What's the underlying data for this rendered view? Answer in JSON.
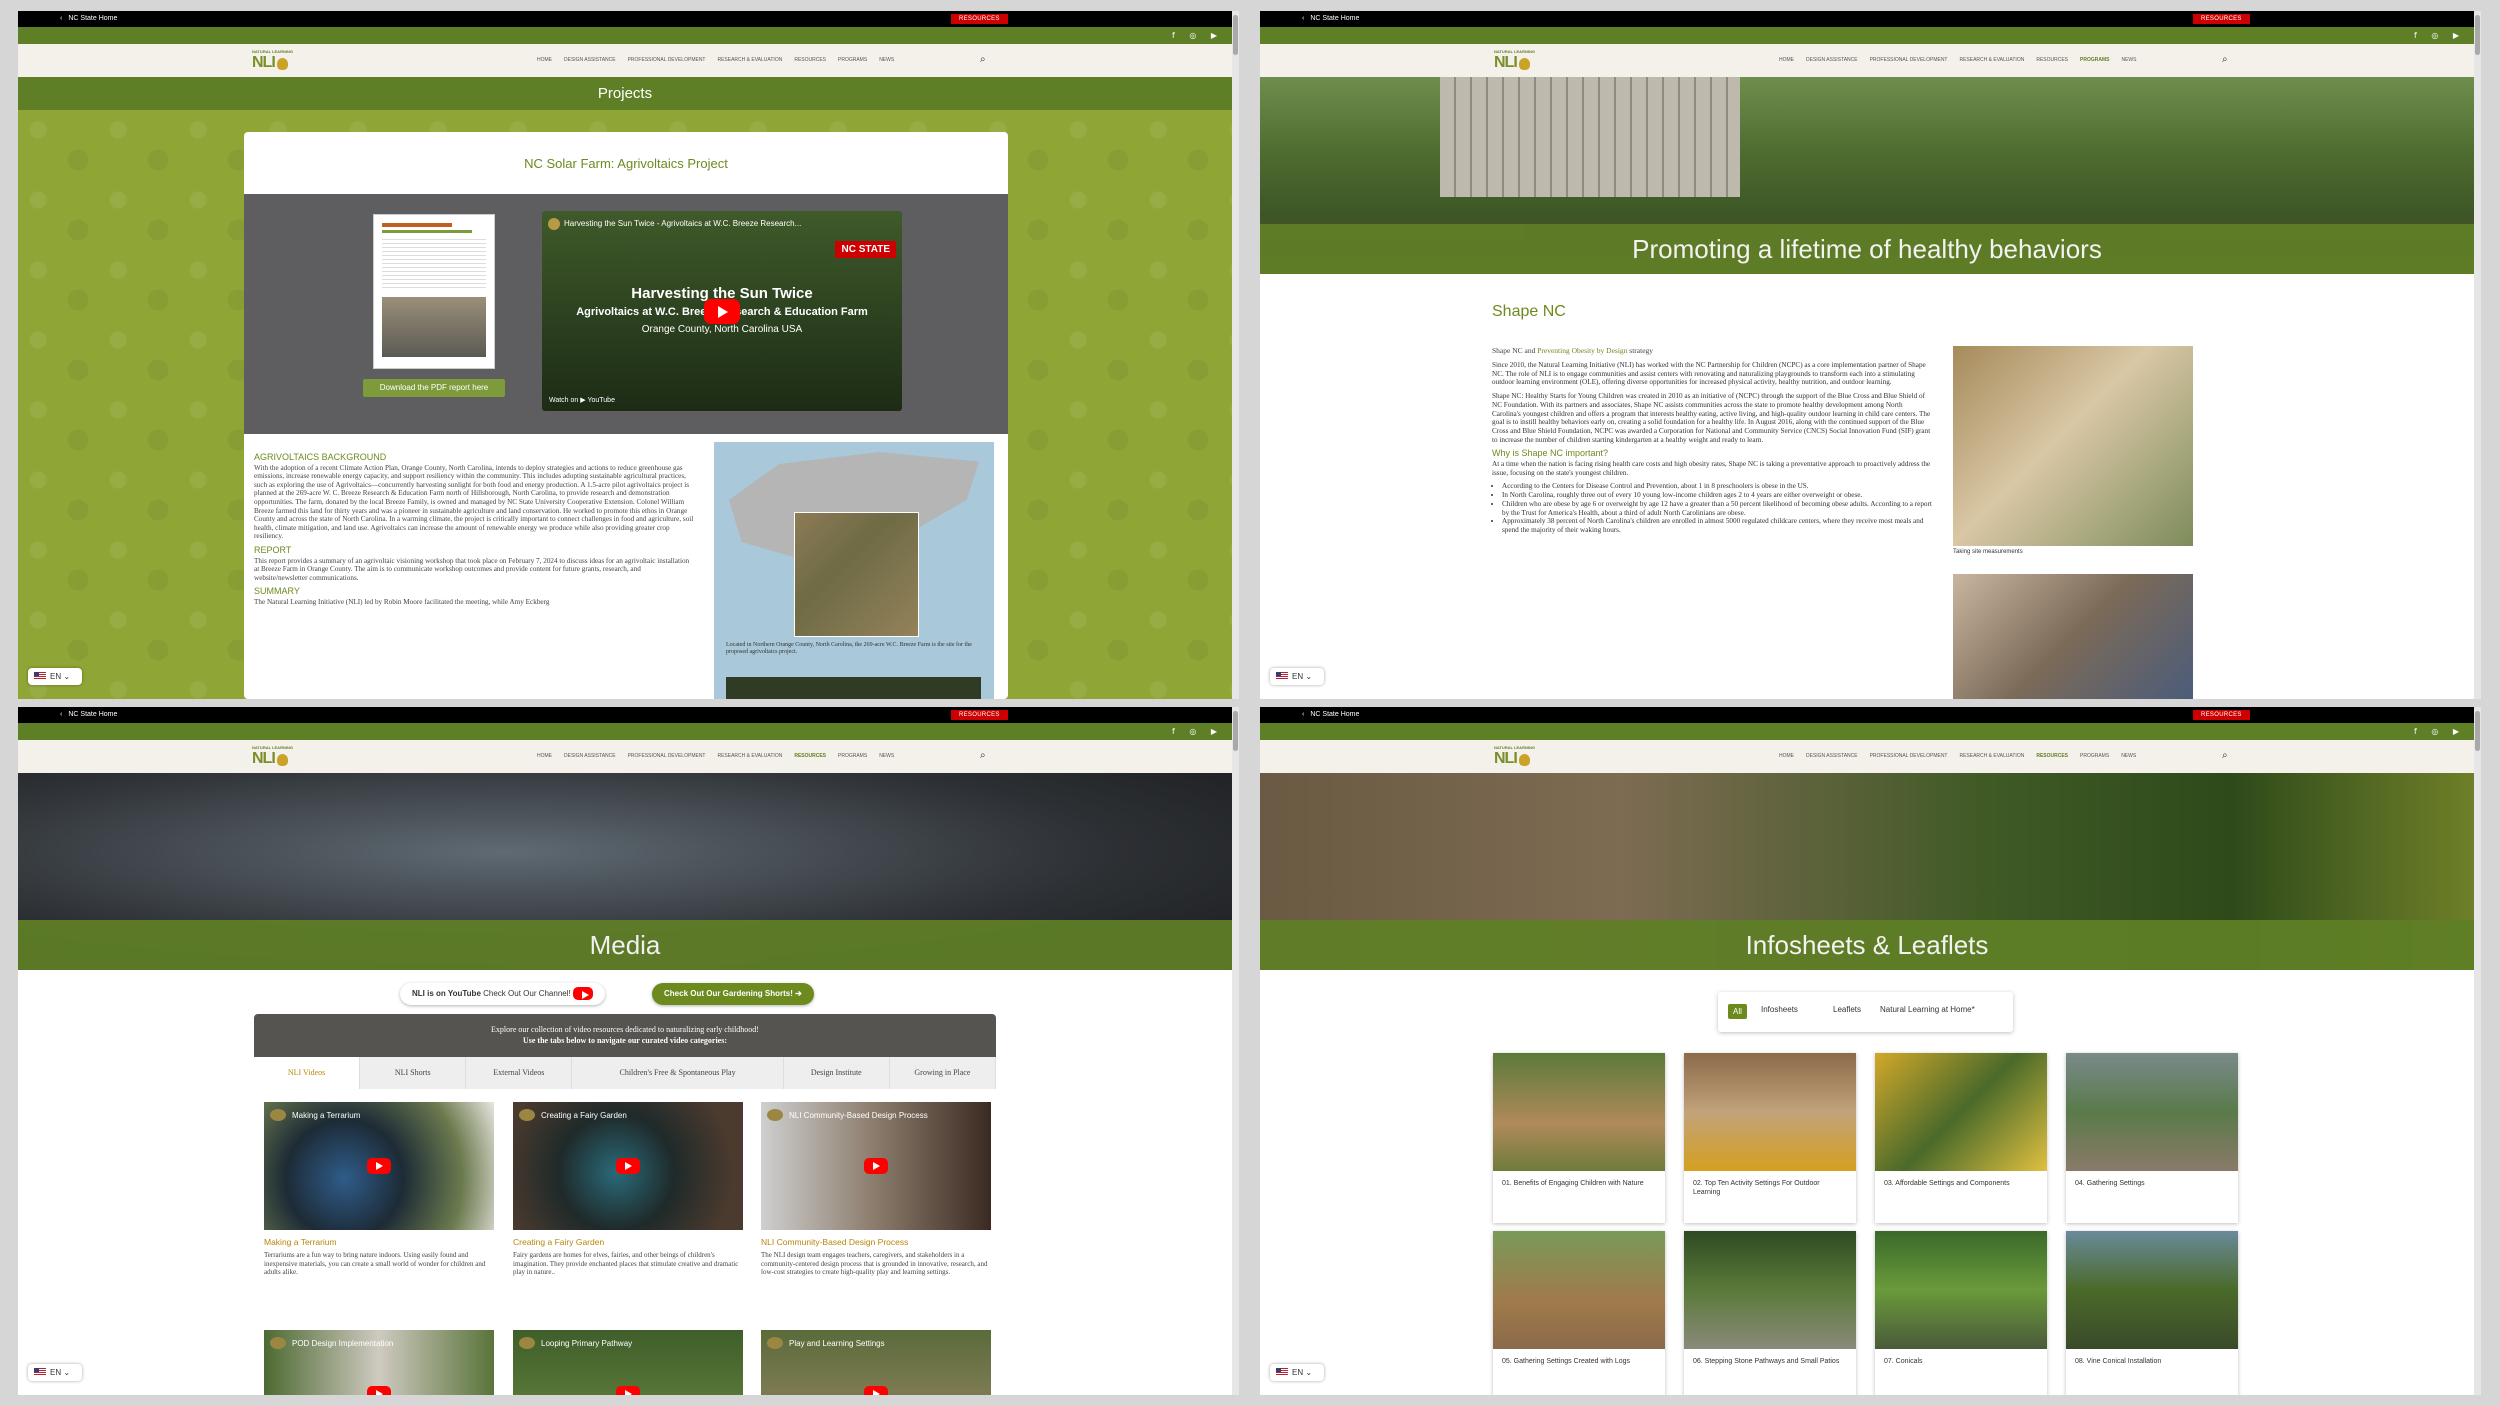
{
  "site": {
    "utility_home": "NC State Home",
    "resources_badge": "RESOURCES",
    "logo_small": "NATURAL LEARNING",
    "logo_big": "NLI",
    "menu": [
      "HOME",
      "DESIGN ASSISTANCE",
      "PROFESSIONAL DEVELOPMENT",
      "RESEARCH & EVALUATION",
      "RESOURCES",
      "PROGRAMS",
      "NEWS"
    ],
    "lang": "EN",
    "social": "f ◎ ▶"
  },
  "projects": {
    "hero": "Projects",
    "title": "NC Solar Farm: Agrivoltaics Project",
    "download_btn": "Download the PDF report here",
    "video": {
      "title": "Harvesting the Sun Twice - Agrivoltaics at W.C. Breeze Research...",
      "badge": "NC STATE",
      "line1": "Harvesting the Sun Twice",
      "line2": "Agrivoltaics at W.C. Breeze Research & Education Farm",
      "line3": "Orange County, North Carolina USA",
      "watch_on": "Watch on ▶ YouTube"
    },
    "h_background": "AGRIVOLTAICS BACKGROUND",
    "p_background": "With the adoption of a recent Climate Action Plan, Orange County, North Carolina, intends to deploy strategies and actions to reduce greenhouse gas emissions, increase renewable energy capacity, and support resiliency within the community. This includes adopting sustainable agricultural practices, such as exploring the use of Agrivoltaics—concurrently harvesting sunlight for both food and energy production. A 1.5-acre pilot agrivoltaics project is planned at the 269-acre W. C. Breeze Research & Education Farm north of Hillsborough, North Carolina, to provide research and demonstration opportunities. The farm, donated by the local Breeze Family, is owned and managed by NC State University Cooperative Extension. Colonel William Breeze farmed this land for thirty years and was a pioneer in sustainable agriculture and land conservation. He worked to promote this ethos in Orange County and across the state of North Carolina. In a warming climate, the project is critically important to connect challenges in food and agriculture, soil health, climate mitigation, and land use. Agrivoltaics can increase the amount of renewable energy we produce while also providing greater crop resiliency.",
    "h_report": "REPORT",
    "p_report": "This report provides a summary of an agrivoltaic visioning workshop that took place on February 7, 2024 to discuss ideas for an agrivoltaic installation at Breeze Farm in Orange County. The aim is to communicate workshop outcomes and provide content for future grants, research, and website/newsletter communications.",
    "h_summary": "SUMMARY",
    "p_summary": "The Natural Learning Initiative (NLI) led by Robin Moore facilitated the meeting, while Amy Eckberg",
    "map_caption": "Located in Northern Orange County, North Carolina, the 269-acre W.C. Breeze Farm is the site for the proposed agrivoltaics project."
  },
  "shape": {
    "hero": "Promoting a lifetime of healthy behaviors",
    "title": "Shape NC",
    "subtitle_a": "Shape NC and",
    "subtitle_b": "Preventing Obesity by Design",
    "subtitle_c": "strategy",
    "p1": "Since 2010, the Natural Learning Initiative (NLI) has worked with the NC Partnership for Children (NCPC) as a core implementation partner of Shape NC. The role of NLI is to engage communities and assist centers with renovating and naturalizing playgrounds to transform each into a stimulating outdoor learning environment (OLE), offering diverse opportunities for increased physical activity, healthy nutrition, and outdoor learning.",
    "p2": "Shape NC: Healthy Starts for Young Children was created in 2010 as an initiative of (NCPC) through the support of the Blue Cross and Blue Shield of NC Foundation. With its partners and associates, Shape NC assists communities across the state to promote healthy development among North Carolina's youngest children and offers a program that interests healthy eating, active living, and high-quality outdoor learning in child care centers. The goal is to instill healthy behaviors early on, creating a solid foundation for a healthy life. In August 2016, along with the continued support of the Blue Cross and Blue Shield Foundation, NCPC was awarded a Corporation for National and Community Service (CNCS) Social Innovation Fund (SIF) grant to increase the number of children starting kindergarten at a healthy weight and ready to learn.",
    "h_why": "Why is Shape NC important?",
    "p3": "At a time when the nation is facing rising health care costs and high obesity rates, Shape NC is taking a preventative approach to proactively address the issue, focusing on the state's youngest children.",
    "bullets": [
      "According to the Centers for Disease Control and Prevention, about 1 in 8 preschoolers is obese in the US.",
      "In North Carolina, roughly three out of every 10 young low-income children ages 2 to 4 years are either overweight or obese.",
      "Children who are obese by age 6 or overweight by age 12 have a greater than a 50 percent likelihood of becoming obese adults. According to a report by the Trust for America's Health, about a third of adult North Carolinians are obese.",
      "Approximately 38 percent of North Carolina's children are enrolled in almost 5000 regulated childcare centers, where they receive most meals and spend the majority of their waking hours."
    ],
    "photo_caption": "Taking site measurements"
  },
  "media": {
    "hero": "Media",
    "yt_a": "NLI is on YouTube",
    "yt_b": "Check Out Our Channel!",
    "shorts": "Check Out Our Gardening Shorts! ➔",
    "intro1": "Explore our collection of video resources dedicated to naturalizing early childhood!",
    "intro2": "Use the tabs below to navigate our curated video categories:",
    "tabs": [
      "NLI Videos",
      "NLI Shorts",
      "External Videos",
      "Children's Free & Spontaneous Play",
      "Design Institute",
      "Growing in Place"
    ],
    "videos": [
      {
        "thumb": "Making a Terrarium",
        "title": "Making a Terrarium",
        "desc": "Terrariums are a fun way to bring nature indoors. Using easily found and inexpensive materials, you can create a small world of wonder for children and adults alike."
      },
      {
        "thumb": "Creating a Fairy Garden",
        "title": "Creating a Fairy Garden",
        "desc": "Fairy gardens are homes for elves, fairies, and other beings of children's imagination. They provide enchanted places that stimulate creative and dramatic play in nature.."
      },
      {
        "thumb": "NLI Community-Based Design Process",
        "title": "NLI Community-Based Design Process",
        "desc": "The NLI design team engages teachers, caregivers, and stakeholders in a community-centered design process that is grounded in innovative, research, and low-cost strategies to create high-quality play and learning settings."
      },
      {
        "thumb": "POD Design Implementation",
        "title": "",
        "desc": ""
      },
      {
        "thumb": "Looping Primary Pathway",
        "title": "",
        "desc": ""
      },
      {
        "thumb": "Play and Learning Settings",
        "title": "",
        "desc": ""
      }
    ]
  },
  "infosheets": {
    "hero": "Infosheets & Leaflets",
    "filters": [
      "All",
      "Infosheets",
      "Leaflets",
      "Natural Learning at Home*"
    ],
    "cards": [
      "01. Benefits of Engaging Children with Nature",
      "02. Top Ten Activity Settings For Outdoor Learning",
      "03. Affordable Settings and Components",
      "04. Gathering Settings",
      "05. Gathering Settings Created with Logs",
      "06. Stepping Stone Pathways and Small Patios",
      "07. Conicals",
      "08. Vine Conical Installation"
    ]
  },
  "colors": {
    "brand_green": "#5f7f26",
    "accent_red": "#cc0000",
    "link_gold": "#b8860b"
  }
}
